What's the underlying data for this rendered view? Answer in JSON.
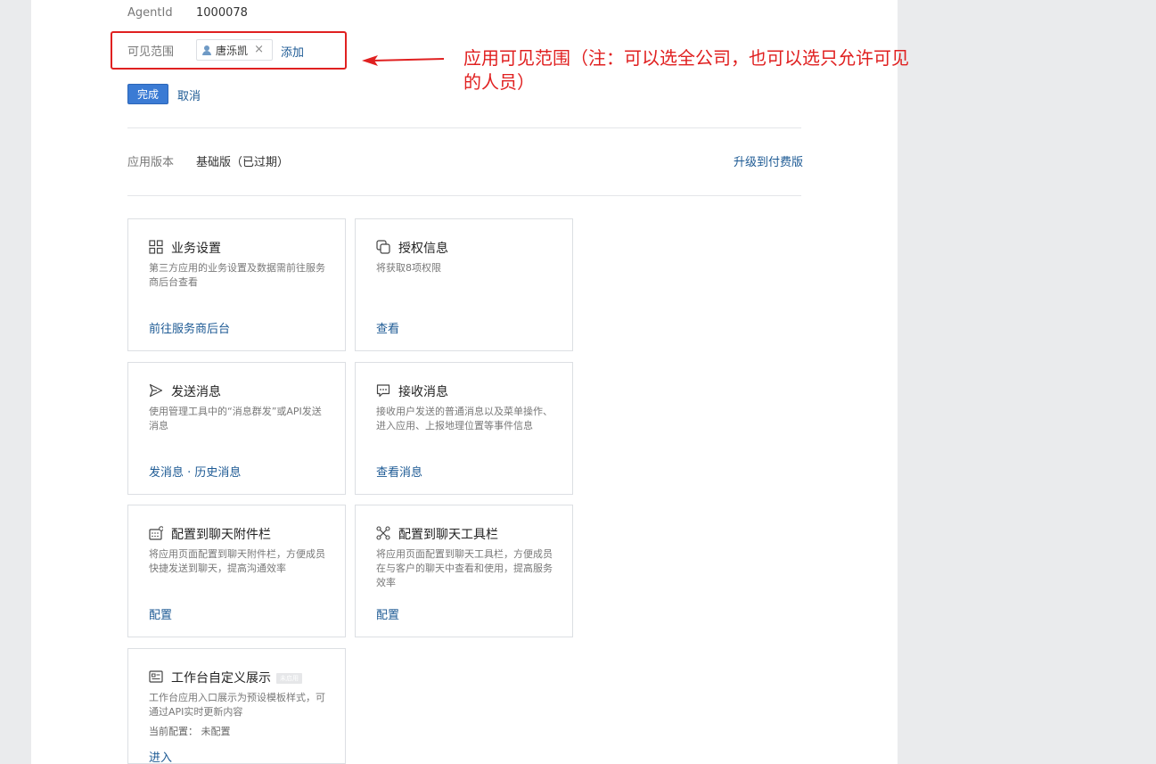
{
  "agent": {
    "label": "AgentId",
    "value": "1000078"
  },
  "visibility": {
    "label": "可见范围",
    "member": "唐泺凯",
    "remove": "×",
    "add": "添加"
  },
  "actions": {
    "done": "完成",
    "cancel": "取消"
  },
  "annotation": {
    "text": "应用可见范围（注：可以选全公司，也可以选只允许可见的人员）",
    "color": "#e02020"
  },
  "version": {
    "label": "应用版本",
    "value": "基础版（已过期）",
    "upgrade": "升级到付费版"
  },
  "cards": [
    {
      "icon": "grid-icon",
      "title": "业务设置",
      "desc": "第三方应用的业务设置及数据需前往服务商后台查看",
      "link": "前往服务商后台"
    },
    {
      "icon": "copy-icon",
      "title": "授权信息",
      "desc": "将获取8项权限",
      "link": "查看"
    },
    {
      "icon": "send-icon",
      "title": "发送消息",
      "desc": "使用管理工具中的“消息群发”或API发送消息",
      "link": "发消息 · 历史消息"
    },
    {
      "icon": "chat-bubble-icon",
      "title": "接收消息",
      "desc": "接收用户发送的普通消息以及菜单操作、进入应用、上报地理位置等事件信息",
      "link": "查看消息"
    },
    {
      "icon": "keyboard-icon",
      "title": "配置到聊天附件栏",
      "desc": "将应用页面配置到聊天附件栏，方便成员快捷发送到聊天，提高沟通效率",
      "link": "配置"
    },
    {
      "icon": "tools-icon",
      "title": "配置到聊天工具栏",
      "desc": "将应用页面配置到聊天工具栏，方便成员在与客户的聊天中查看和使用，提高服务效率",
      "link": "配置"
    },
    {
      "icon": "dashboard-icon",
      "title": "工作台自定义展示",
      "badge": "未启用",
      "desc": "工作台应用入口展示为预设模板样式，可通过API实时更新内容",
      "meta": "当前配置：  未配置",
      "link": "进入"
    }
  ],
  "colors": {
    "link": "#1d5a94",
    "primary": "#3b7bd4",
    "annotation": "#e02020"
  }
}
